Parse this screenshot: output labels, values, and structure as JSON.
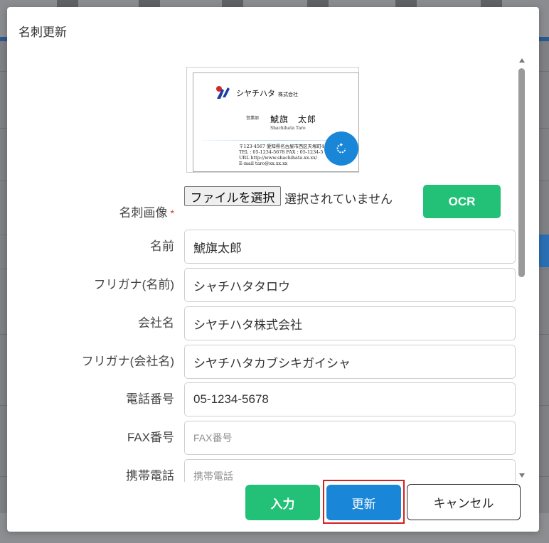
{
  "dialog": {
    "title": "名刺更新"
  },
  "card_preview": {
    "company": "シヤチハタ",
    "company_suffix": "株式会社",
    "department": "営業部",
    "name": "鯱旗　太郎",
    "name_roman": "Shachihata Taro",
    "address_line": "〒123-4567  愛知県名古屋市西区天塚町4",
    "tel_line": "TEL : 05-1234-5678 FAX : 05-1234-5",
    "url_line": "URL http://www.shachihata.xx.xx/",
    "email_line": "E-mail taro@xx.xx.xx",
    "rotate_icon": "rotate-icon",
    "colors": {
      "rotate_button": "#1a86d8",
      "logo_blue": "#1a3fa3",
      "logo_red": "#d8262b"
    }
  },
  "form": {
    "image_label": "名刺画像",
    "required_mark": "*",
    "file_button": "ファイルを選択",
    "file_status": "選択されていません",
    "ocr_button": "OCR",
    "fields": [
      {
        "label": "名前",
        "value": "鯱旗太郎",
        "placeholder": ""
      },
      {
        "label": "フリガナ(名前)",
        "value": "シャチハタタロウ",
        "placeholder": ""
      },
      {
        "label": "会社名",
        "value": "シヤチハタ株式会社",
        "placeholder": ""
      },
      {
        "label": "フリガナ(会社名)",
        "value": "シヤチハタカブシキガイシャ",
        "placeholder": ""
      },
      {
        "label": "電話番号",
        "value": "05-1234-5678",
        "placeholder": ""
      },
      {
        "label": "FAX番号",
        "value": "",
        "placeholder": "FAX番号"
      },
      {
        "label": "携帯電話",
        "value": "",
        "placeholder": "携帯電話"
      }
    ]
  },
  "footer": {
    "input_button": "入力",
    "update_button": "更新",
    "cancel_button": "キャンセル"
  },
  "colors": {
    "green": "#22c177",
    "blue": "#1a86d8",
    "highlight": "#d42020",
    "required": "#d9342b"
  }
}
